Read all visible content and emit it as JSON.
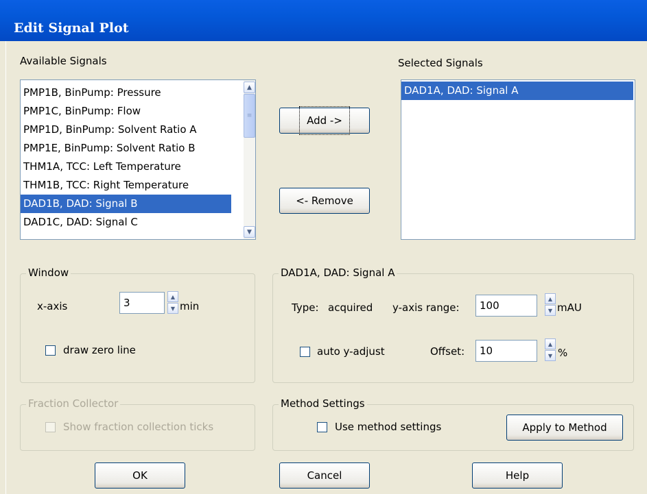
{
  "window": {
    "title": "Edit Signal Plot"
  },
  "available": {
    "label": "Available Signals",
    "items": [
      "PMP1B, BinPump: Pressure",
      "PMP1C, BinPump: Flow",
      "PMP1D, BinPump: Solvent Ratio A",
      "PMP1E, BinPump: Solvent Ratio B",
      "THM1A, TCC: Left Temperature",
      "THM1B, TCC: Right Temperature",
      "DAD1B, DAD: Signal B",
      "DAD1C, DAD: Signal C"
    ],
    "selected_index": 6
  },
  "selected": {
    "label": "Selected Signals",
    "items": [
      "DAD1A, DAD: Signal A"
    ],
    "selected_index": 0
  },
  "buttons": {
    "add": "Add ->",
    "remove": "<- Remove",
    "apply": "Apply to Method",
    "ok": "OK",
    "cancel": "Cancel",
    "help": "Help"
  },
  "window_group": {
    "title": "Window",
    "xaxis_label": "x-axis",
    "xaxis_value": "3",
    "xaxis_unit": "min",
    "draw_zero_line": "draw zero line",
    "draw_zero_checked": false
  },
  "signal_group": {
    "title": "DAD1A, DAD: Signal A",
    "type_label": "Type:",
    "type_value": "acquired",
    "yrange_label": "y-axis range:",
    "yrange_value": "100",
    "yrange_unit": "mAU",
    "auto_y": "auto y-adjust",
    "auto_y_checked": false,
    "offset_label": "Offset:",
    "offset_value": "10",
    "offset_unit": "%"
  },
  "fraction_group": {
    "title": "Fraction Collector",
    "show_ticks": "Show fraction collection ticks",
    "enabled": false
  },
  "method_group": {
    "title": "Method Settings",
    "use_method": "Use method settings",
    "use_method_checked": false
  }
}
